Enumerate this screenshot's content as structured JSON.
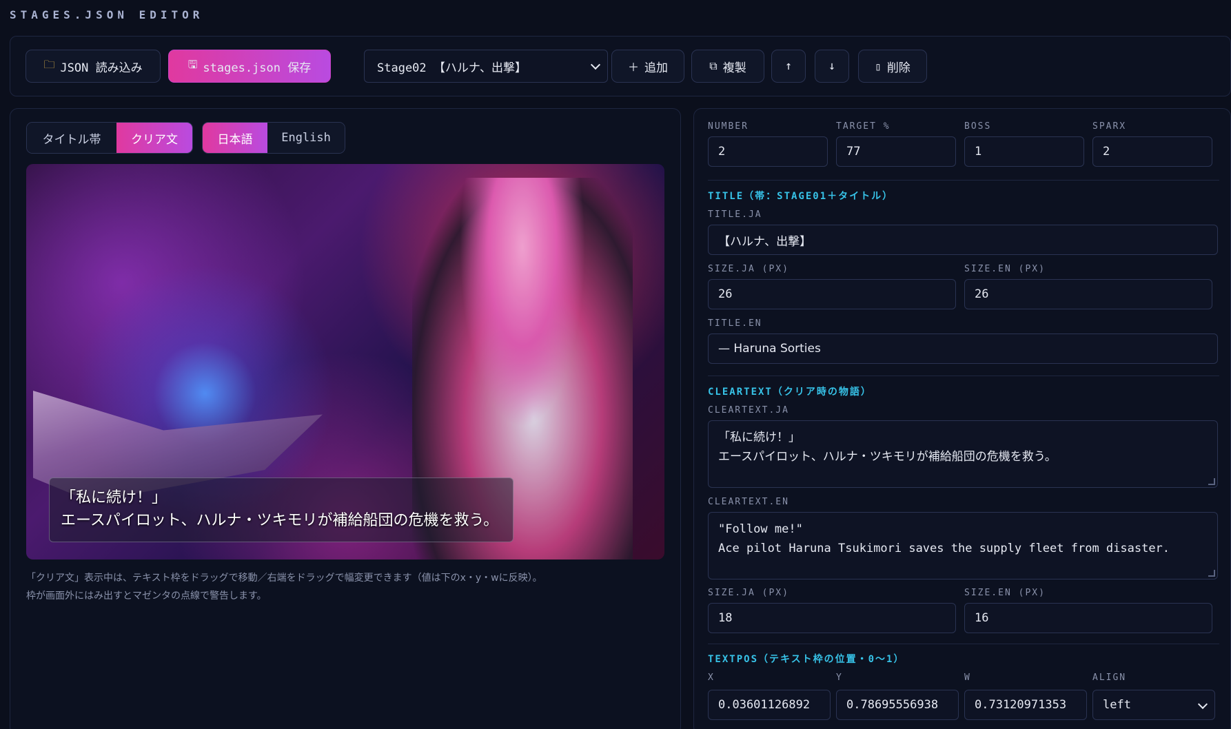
{
  "app": {
    "title": "STAGES.JSON EDITOR"
  },
  "toolbar": {
    "load_label": "JSON 読み込み",
    "save_label": "stages.json 保存",
    "stage_select": "Stage02 【ハルナ、出撃】",
    "add_label": "追加",
    "dup_label": "複製",
    "up_label": "↑",
    "down_label": "↓",
    "delete_label": "削除"
  },
  "preview": {
    "tabs": [
      "タイトル帯",
      "クリア文"
    ],
    "active_tab": "クリア文",
    "langs": [
      "日本語",
      "English"
    ],
    "active_lang": "日本語",
    "overlay_lines": [
      "「私に続け！」",
      "エースパイロット、ハルナ・ツキモリが補給船団の危機を救う。"
    ],
    "hint_lines": [
      "「クリア文」表示中は、テキスト枠をドラッグで移動／右端をドラッグで幅変更できます（値は下のx・y・wに反映）。",
      "枠が画面外にはみ出すとマゼンタの点線で警告します。"
    ]
  },
  "form": {
    "number_label": "NUMBER",
    "number": "2",
    "target_label": "TARGET %",
    "target": "77",
    "boss_label": "BOSS",
    "boss": "1",
    "sparx_label": "SPARX",
    "sparx": "2",
    "title_section": "TITLE（帯：STAGE01＋タイトル）",
    "title_ja_label": "TITLE.JA",
    "title_ja": "【ハルナ、出撃】",
    "size_ja_label": "SIZE.JA (PX)",
    "title_size_ja": "26",
    "size_en_label": "SIZE.EN (PX)",
    "title_size_en": "26",
    "title_en_label": "TITLE.EN",
    "title_en": "— Haruna Sorties",
    "cleartext_section": "CLEARTEXT（クリア時の物語）",
    "cleartext_ja_label": "CLEARTEXT.JA",
    "cleartext_ja": [
      "「私に続け！」",
      "エースパイロット、ハルナ・ツキモリが補給船団の危機を救う。"
    ],
    "cleartext_en_label": "CLEARTEXT.EN",
    "cleartext_en": [
      "\"Follow me!\"",
      "Ace pilot Haruna Tsukimori saves the supply fleet from disaster."
    ],
    "clear_size_ja": "18",
    "clear_size_en": "16",
    "textpos_section": "TEXTPOS（テキスト枠の位置・0〜1）",
    "x_label": "X",
    "x": "0.03601126892",
    "y_label": "Y",
    "y": "0.78695556938",
    "w_label": "W",
    "w": "0.73120971353",
    "align_label": "ALIGN",
    "align": "left"
  },
  "colors": {
    "accent_start": "#e0399f",
    "accent_end": "#b94be0",
    "section": "#37c3e8",
    "background": "#0b0f1c"
  },
  "icons": {
    "load": "folder-icon",
    "save": "floppy-icon",
    "add": "plus-icon",
    "dup": "copy-icon",
    "delete": "trash-icon"
  }
}
